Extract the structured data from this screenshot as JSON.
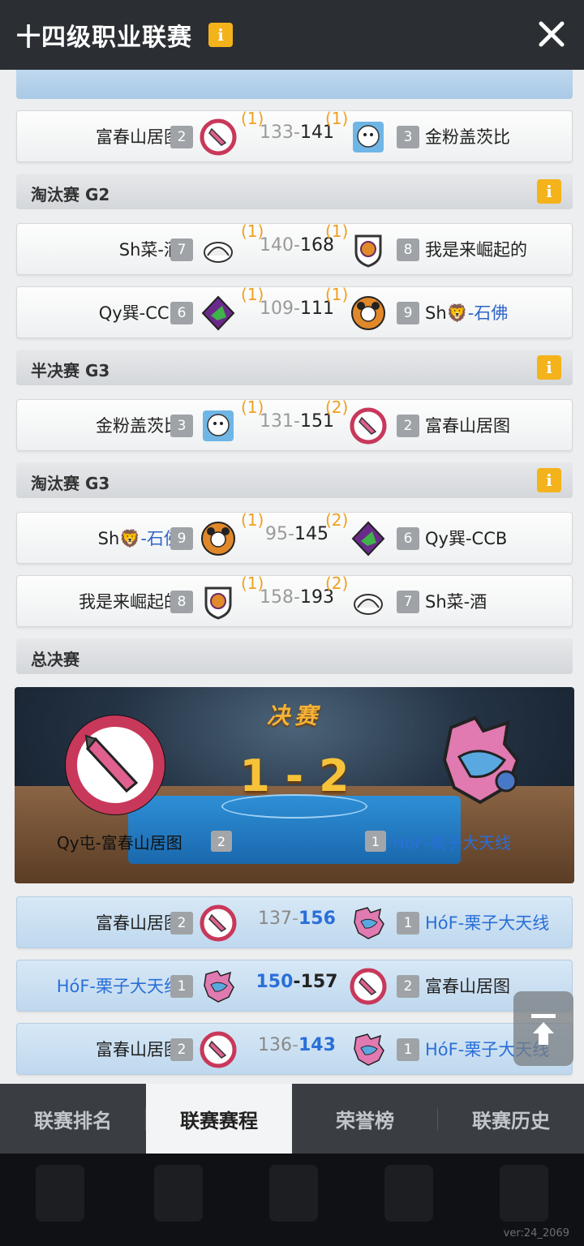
{
  "header": {
    "title": "十四级职业联赛",
    "info_label": "i"
  },
  "sections": [
    {
      "title": "淘汰赛 G2",
      "info_label": "i"
    },
    {
      "title": "半决赛 G3",
      "info_label": "i"
    },
    {
      "title": "淘汰赛 G3",
      "info_label": "i"
    },
    {
      "title": "总决赛"
    }
  ],
  "matches": [
    {
      "left": "富春山居图",
      "left_seed": "2",
      "left_wins": "(1)",
      "s1": "133",
      "dash": "-",
      "s2": "141",
      "right_wins": "(1)",
      "right": "金粉盖茨比",
      "right_seed": "3"
    },
    {
      "left": "Sh菜-酒",
      "left_seed": "7",
      "left_wins": "(1)",
      "s1": "140",
      "dash": "-",
      "s2": "168",
      "right_wins": "(1)",
      "right": "我是来崛起的",
      "right_seed": "8"
    },
    {
      "left": "Qy巽-CCB",
      "left_seed": "6",
      "left_wins": "(1)",
      "s1": "109",
      "dash": "-",
      "s2": "111",
      "right_wins": "(1)",
      "right_a": "Sh",
      "right_b": "-石佛",
      "right_seed": "9"
    },
    {
      "left": "金粉盖茨比",
      "left_seed": "3",
      "left_wins": "(1)",
      "s1": "131",
      "dash": "-",
      "s2": "151",
      "right_wins": "(2)",
      "right": "富春山居图",
      "right_seed": "2"
    },
    {
      "left_a": "Sh",
      "left_b": "-石佛",
      "left_seed": "9",
      "left_wins": "(1)",
      "s1": "95",
      "dash": "-",
      "s2": "145",
      "right_wins": "(2)",
      "right": "Qy巽-CCB",
      "right_seed": "6"
    },
    {
      "left": "我是来崛起的",
      "left_seed": "8",
      "left_wins": "(1)",
      "s1": "158",
      "dash": "-",
      "s2": "193",
      "right_wins": "(2)",
      "right": "Sh菜-酒",
      "right_seed": "7"
    }
  ],
  "final": {
    "title": "决赛",
    "score": "1 - 2",
    "left_name": "Qy屯-富春山居图",
    "left_seed": "2",
    "right_name": "HóF-栗子大天线",
    "right_seed": "1"
  },
  "final_games": [
    {
      "left": "富春山居图",
      "left_seed": "2",
      "s1": "137",
      "dash": "-",
      "s2": "156",
      "right": "HóF-栗子大天线",
      "right_seed": "1"
    },
    {
      "left": "HóF-栗子大天线",
      "left_seed": "1",
      "s1": "150",
      "dash": "-",
      "s2": "157",
      "right": "富春山居图",
      "right_seed": "2"
    },
    {
      "left": "富春山居图",
      "left_seed": "2",
      "s1": "136",
      "dash": "-",
      "s2": "143",
      "right": "HóF-栗子大天线",
      "right_seed": "1"
    }
  ],
  "tabs": [
    "联赛排名",
    "联赛赛程",
    "荣誉榜",
    "联赛历史"
  ],
  "active_tab": "联赛赛程",
  "version": "ver:24_2069",
  "colors": {
    "accent_gold": "#f4b21b",
    "win_blue": "#2a6fd8",
    "header_bg": "#2b2f34"
  },
  "icons": [
    "info-icon",
    "close-icon",
    "scroll-top-icon",
    "lion-emoji-icon"
  ]
}
